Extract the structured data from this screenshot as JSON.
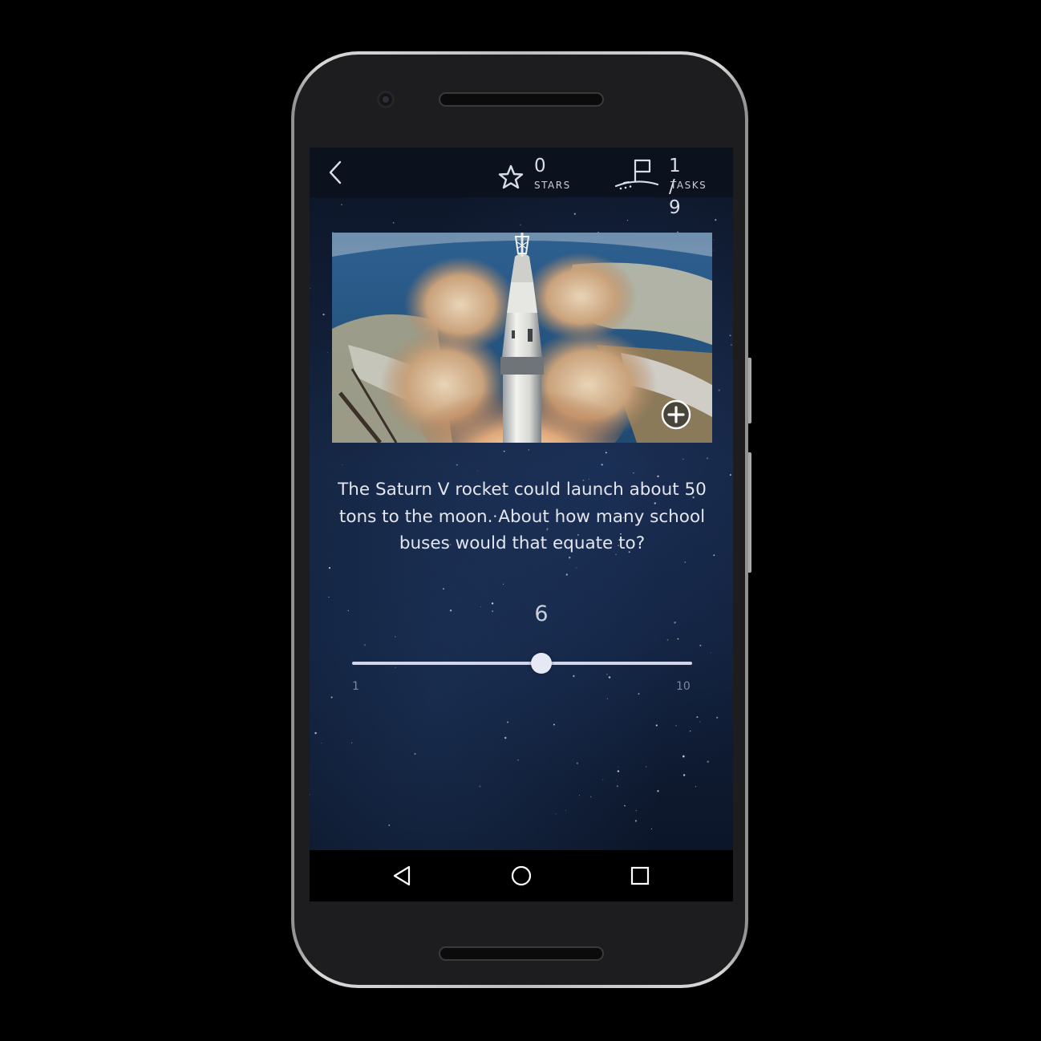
{
  "topbar": {
    "back_icon": "chevron-left-icon",
    "stars": {
      "value": "0",
      "label": "STARS",
      "icon": "star-icon"
    },
    "tasks": {
      "value": "1 / 9",
      "label": "TASKS",
      "icon": "moon-flag-icon"
    }
  },
  "image": {
    "zoom_icon": "plus-circle-icon"
  },
  "question": {
    "text": "The Saturn V rocket could launch about 50 tons to the moon. About how many school buses would that equate to?"
  },
  "slider": {
    "value": 6,
    "value_text": "6",
    "min": 1,
    "max": 10,
    "min_label": "1",
    "max_label": "10"
  },
  "navbar": {
    "back_icon": "triangle-back-icon",
    "home_icon": "circle-home-icon",
    "recents_icon": "square-recents-icon"
  },
  "colors": {
    "topbar_bg": "#0b111d",
    "text": "#e3e6ee",
    "slider_track": "#d3d6ea",
    "slider_thumb": "#e6e8f4"
  }
}
